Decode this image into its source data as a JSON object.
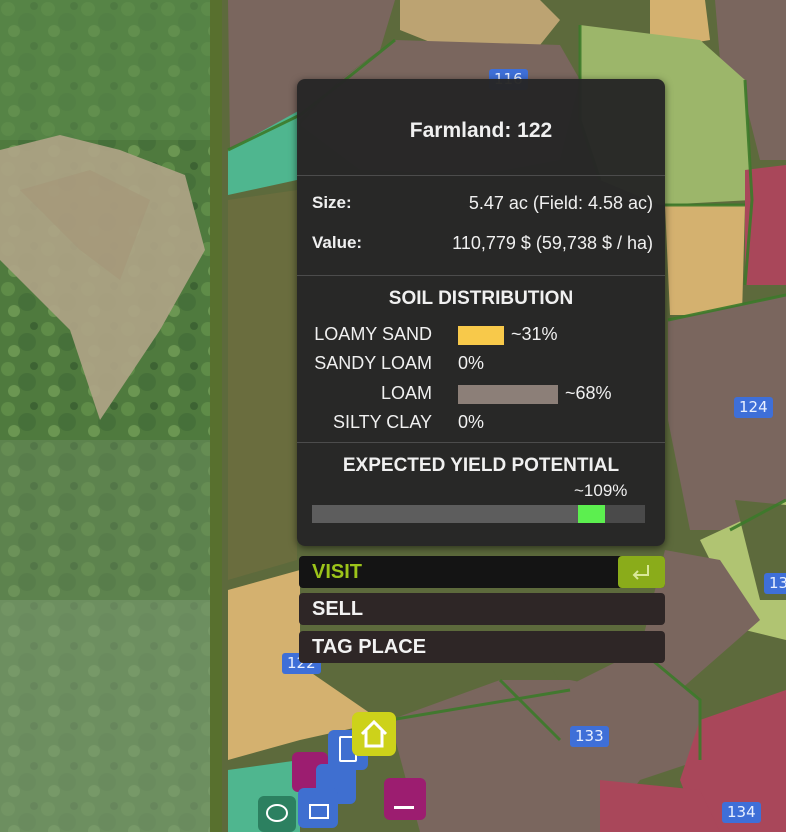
{
  "map": {
    "field_tags": [
      "116",
      "124",
      "122",
      "133",
      "134",
      "13",
      "22"
    ]
  },
  "farmland_panel": {
    "title": "Farmland: 122",
    "size_label": "Size:",
    "size_value": "5.47 ac (Field: 4.58 ac)",
    "value_label": "Value:",
    "value_value": "110,779 $ (59,738 $ / ha)",
    "soil_heading": "SOIL DISTRIBUTION",
    "soils": [
      {
        "name": "LOAMY SAND",
        "pct_text": "~31%",
        "fraction": 0.31,
        "color": "#f8c94a"
      },
      {
        "name": "SANDY LOAM",
        "pct_text": "0%",
        "fraction": 0,
        "color": "#c9b07a"
      },
      {
        "name": "LOAM",
        "pct_text": "~68%",
        "fraction": 0.68,
        "color": "#8c7f78"
      },
      {
        "name": "SILTY CLAY",
        "pct_text": "0%",
        "fraction": 0,
        "color": "#8a6d60"
      }
    ],
    "yield_heading": "EXPECTED YIELD POTENTIAL",
    "yield_text": "~109%",
    "yield_fraction": 0.8,
    "yield_marker_color": "#5cef4f"
  },
  "actions": {
    "visit": "VISIT",
    "sell": "SELL",
    "tag_place": "TAG PLACE",
    "visit_color": "#9cc41a",
    "enter_icon": "enter-key-icon"
  },
  "hotspots": [
    "farmhouse-icon",
    "fuel-pump-icon",
    "sell-point-icon",
    "animal-pig-icon",
    "storage-icon"
  ]
}
